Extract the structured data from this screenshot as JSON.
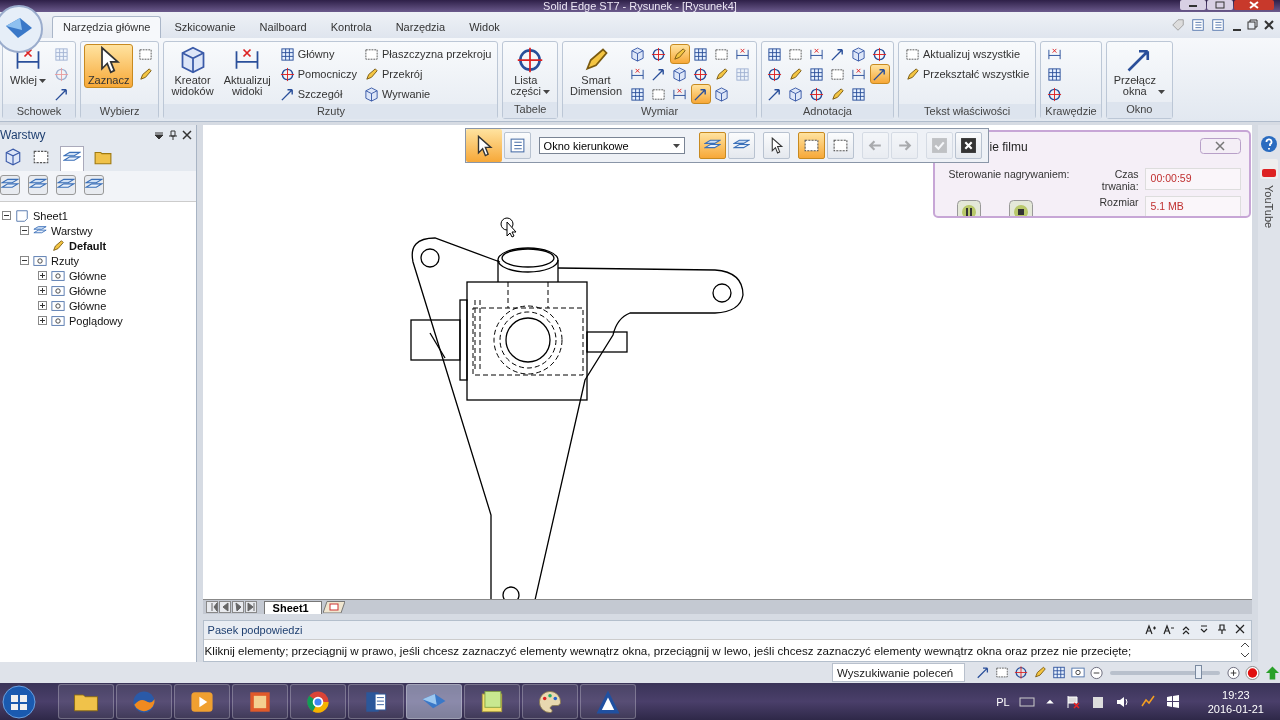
{
  "window": {
    "title": "Solid Edge ST7 - Rysunek - [Rysunek4]"
  },
  "ribbon_tabs": [
    {
      "label": "Narzędzia główne",
      "selected": true
    },
    {
      "label": "Szkicowanie",
      "selected": false
    },
    {
      "label": "Nailboard",
      "selected": false
    },
    {
      "label": "Kontrola",
      "selected": false
    },
    {
      "label": "Narzędzia",
      "selected": false
    },
    {
      "label": "Widok",
      "selected": false
    }
  ],
  "ribbon": {
    "groups": [
      {
        "label": "Schowek",
        "items": [
          {
            "kind": "large",
            "label": "Wklej",
            "dropdown": true,
            "selected": false
          },
          {
            "kind": "tool",
            "selected": false,
            "disabled": true
          },
          {
            "kind": "tool",
            "selected": false,
            "disabled": true
          },
          {
            "kind": "tool",
            "selected": false,
            "disabled": false
          }
        ]
      },
      {
        "label": "Wybierz",
        "items": [
          {
            "kind": "large",
            "label": "Zaznacz",
            "dropdown": false,
            "selected": true
          },
          {
            "kind": "tool",
            "selected": false,
            "disabled": false
          },
          {
            "kind": "tool",
            "selected": false,
            "disabled": false
          }
        ]
      },
      {
        "label": "Rzuty",
        "items": [
          {
            "kind": "large",
            "label": "Kreator widoków",
            "dropdown": false,
            "selected": false
          },
          {
            "kind": "large",
            "label": "Aktualizuj widoki",
            "dropdown": false,
            "selected": false
          },
          {
            "kind": "small",
            "label": "Główny"
          },
          {
            "kind": "small",
            "label": "Pomocniczy"
          },
          {
            "kind": "small",
            "label": "Szczegół"
          },
          {
            "kind": "small",
            "label": "Płaszczyzna przekroju"
          },
          {
            "kind": "small",
            "label": "Przekrój"
          },
          {
            "kind": "small",
            "label": "Wyrwanie"
          }
        ]
      },
      {
        "label": "Tabele",
        "items": [
          {
            "kind": "large",
            "label": "Lista części",
            "dropdown": true,
            "selected": false
          }
        ]
      },
      {
        "label": "Wymiar",
        "items": [
          {
            "kind": "large",
            "label": "Smart Dimension",
            "dropdown": false,
            "selected": false
          },
          {
            "kind": "tool",
            "selected": false,
            "disabled": false
          },
          {
            "kind": "tool",
            "selected": false,
            "disabled": false
          },
          {
            "kind": "tool",
            "selected": false,
            "disabled": false
          },
          {
            "kind": "tool",
            "selected": false,
            "disabled": false
          },
          {
            "kind": "tool",
            "selected": false,
            "disabled": false
          },
          {
            "kind": "tool",
            "selected": false,
            "disabled": false
          },
          {
            "kind": "tool",
            "selected": true,
            "disabled": false
          },
          {
            "kind": "tool",
            "selected": false,
            "disabled": false
          },
          {
            "kind": "tool",
            "selected": false,
            "disabled": false
          },
          {
            "kind": "tool",
            "selected": false,
            "disabled": false
          },
          {
            "kind": "tool",
            "selected": false,
            "disabled": false
          },
          {
            "kind": "tool",
            "selected": true,
            "disabled": false
          },
          {
            "kind": "tool",
            "selected": false,
            "disabled": false
          },
          {
            "kind": "tool",
            "selected": false,
            "disabled": false
          },
          {
            "kind": "tool",
            "selected": false,
            "disabled": false
          },
          {
            "kind": "tool",
            "selected": false,
            "disabled": false
          },
          {
            "kind": "tool",
            "selected": false,
            "disabled": true
          }
        ]
      },
      {
        "label": "Adnotacja",
        "items": [
          {
            "kind": "tool",
            "selected": false,
            "disabled": false
          },
          {
            "kind": "tool",
            "selected": false,
            "disabled": false
          },
          {
            "kind": "tool",
            "selected": false,
            "disabled": false
          },
          {
            "kind": "tool",
            "selected": false,
            "disabled": false
          },
          {
            "kind": "tool",
            "selected": false,
            "disabled": false
          },
          {
            "kind": "tool",
            "selected": false,
            "disabled": false
          },
          {
            "kind": "tool",
            "selected": false,
            "disabled": false
          },
          {
            "kind": "tool",
            "selected": false,
            "disabled": false
          },
          {
            "kind": "tool",
            "selected": false,
            "disabled": false
          },
          {
            "kind": "tool",
            "selected": false,
            "disabled": false
          },
          {
            "kind": "tool",
            "selected": false,
            "disabled": false
          },
          {
            "kind": "tool",
            "selected": false,
            "disabled": false
          },
          {
            "kind": "tool",
            "selected": false,
            "disabled": false
          },
          {
            "kind": "tool",
            "selected": false,
            "disabled": false
          },
          {
            "kind": "tool",
            "selected": false,
            "disabled": false
          },
          {
            "kind": "tool",
            "selected": false,
            "disabled": false
          },
          {
            "kind": "tool",
            "selected": true,
            "disabled": false
          }
        ]
      },
      {
        "label": "Tekst właściwości",
        "items": [
          {
            "kind": "small",
            "label": "Aktualizuj wszystkie"
          },
          {
            "kind": "small",
            "label": "Przekształć wszystkie"
          }
        ]
      },
      {
        "label": "Krawędzie",
        "items": [
          {
            "kind": "tool",
            "selected": false,
            "disabled": false
          },
          {
            "kind": "tool",
            "selected": false,
            "disabled": false
          },
          {
            "kind": "tool",
            "selected": false,
            "disabled": false
          }
        ]
      },
      {
        "label": "Okno",
        "items": [
          {
            "kind": "large",
            "label": "Przełącz okna",
            "dropdown": true,
            "selected": false
          }
        ]
      }
    ]
  },
  "layers_panel": {
    "title": "Warstwy",
    "tabs": [
      {
        "kind": "parts",
        "selected": false
      },
      {
        "kind": "select",
        "selected": false
      },
      {
        "kind": "layers",
        "selected": true
      },
      {
        "kind": "help",
        "selected": false
      }
    ],
    "tree": [
      {
        "label": "Sheet1",
        "kind": "sheet",
        "expanded": true,
        "active": false,
        "children": [
          {
            "label": "Warstwy",
            "kind": "layers",
            "expanded": true,
            "active": false,
            "children": [
              {
                "label": "Default",
                "kind": "layer",
                "active": true
              }
            ]
          },
          {
            "label": "Rzuty",
            "kind": "views",
            "expanded": true,
            "active": false,
            "children": [
              {
                "label": "Główne",
                "kind": "view",
                "expanded": false,
                "active": false
              },
              {
                "label": "Główne",
                "kind": "view",
                "expanded": false,
                "active": false
              },
              {
                "label": "Główne",
                "kind": "view",
                "expanded": false,
                "active": false
              },
              {
                "label": "Poglądowy",
                "kind": "view",
                "expanded": false,
                "active": false
              }
            ]
          }
        ]
      }
    ]
  },
  "select_toolbar": {
    "tools": [
      {
        "kind": "select",
        "selected": true,
        "disabled": false
      },
      {
        "kind": "list",
        "selected": false,
        "disabled": false
      },
      {
        "kind": "dropdown",
        "value": "Okno kierunkowe"
      },
      {
        "kind": "layer-down",
        "selected": true,
        "disabled": false
      },
      {
        "kind": "layer-up",
        "selected": false,
        "disabled": false
      },
      {
        "kind": "quick",
        "selected": false,
        "disabled": false
      },
      {
        "kind": "box",
        "selected": true,
        "disabled": false
      },
      {
        "kind": "cross",
        "selected": false,
        "disabled": false
      },
      {
        "kind": "back",
        "selected": false,
        "disabled": true
      },
      {
        "kind": "forward",
        "selected": false,
        "disabled": true
      },
      {
        "kind": "accept",
        "selected": false,
        "disabled": true
      },
      {
        "kind": "cancel",
        "selected": false,
        "disabled": false
      }
    ]
  },
  "recording_panel": {
    "title": "ie filmu",
    "control_label": "Sterowanie nagrywaniem:",
    "fields": [
      {
        "label": "Czas trwania:",
        "value": "00:00:59"
      },
      {
        "label": "Rozmiar",
        "value": "5.1 MB"
      }
    ]
  },
  "side_tab": "YouTube",
  "sheet_tabs": [
    {
      "label": "Sheet1",
      "selected": true
    }
  ],
  "hint_bar": {
    "title": "Pasek podpowiedzi",
    "text": "Kliknij elementy; przeciągnij w prawo, jeśli chcesz zaznaczyć elementy wewnątrz okna, przeciągnij w lewo, jeśli chcesz zaznaczyć elementy wewnątrz okna oraz przez nie przecięte;"
  },
  "status_bar": {
    "search_placeholder": "Wyszukiwanie poleceń",
    "zoom": {
      "level": 0.8
    }
  },
  "taskbar": {
    "apps": [
      {
        "kind": "folder",
        "selected": false
      },
      {
        "kind": "globe",
        "selected": false
      },
      {
        "kind": "media",
        "selected": false
      },
      {
        "kind": "box",
        "selected": false
      },
      {
        "kind": "wheel",
        "selected": false
      },
      {
        "kind": "document",
        "selected": false
      },
      {
        "kind": "solid",
        "selected": true
      },
      {
        "kind": "notes",
        "selected": false
      },
      {
        "kind": "palette",
        "selected": false
      },
      {
        "kind": "triangle",
        "selected": false
      }
    ],
    "language": "PL",
    "time": "19:23",
    "date": "2016-01-21"
  }
}
